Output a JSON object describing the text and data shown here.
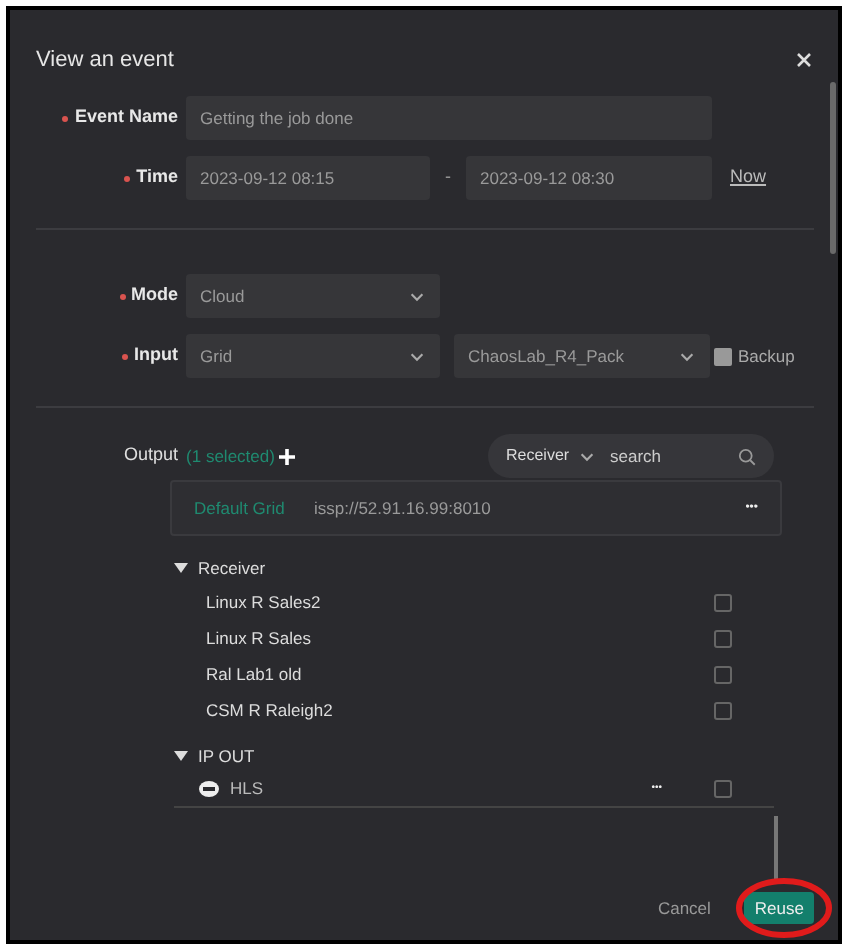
{
  "dialog": {
    "title": "View an event"
  },
  "fields": {
    "event_name": {
      "label": "Event Name",
      "required": true,
      "value": "Getting the job done"
    },
    "time": {
      "label": "Time",
      "required": true,
      "start": "2023-09-12 08:15",
      "separator": "-",
      "end": "2023-09-12 08:30",
      "now_link": "Now"
    },
    "mode": {
      "label": "Mode",
      "required": true,
      "value": "Cloud"
    },
    "input": {
      "label": "Input",
      "required": true,
      "source": "Grid",
      "pack": "ChaosLab_R4_Pack",
      "backup": {
        "label": "Backup",
        "checked": false
      }
    }
  },
  "output": {
    "label": "Output",
    "selected_count": "(1 selected)",
    "filter": "Receiver",
    "search_placeholder": "search",
    "default_item": {
      "name": "Default Grid",
      "address": "issp://52.91.16.99:8010",
      "menu": "•••"
    },
    "groups": [
      {
        "label": "Receiver",
        "expanded": true,
        "items": [
          {
            "name": "Linux R Sales2",
            "checked": false
          },
          {
            "name": "Linux R Sales",
            "checked": false
          },
          {
            "name": "Ral Lab1 old",
            "checked": false
          },
          {
            "name": "CSM R Raleigh2",
            "checked": false
          }
        ]
      },
      {
        "label": "IP OUT",
        "expanded": true,
        "items": [
          {
            "name": "HLS",
            "checked": false,
            "menu": "•••"
          }
        ]
      }
    ]
  },
  "buttons": {
    "cancel": "Cancel",
    "reuse": "Reuse"
  }
}
